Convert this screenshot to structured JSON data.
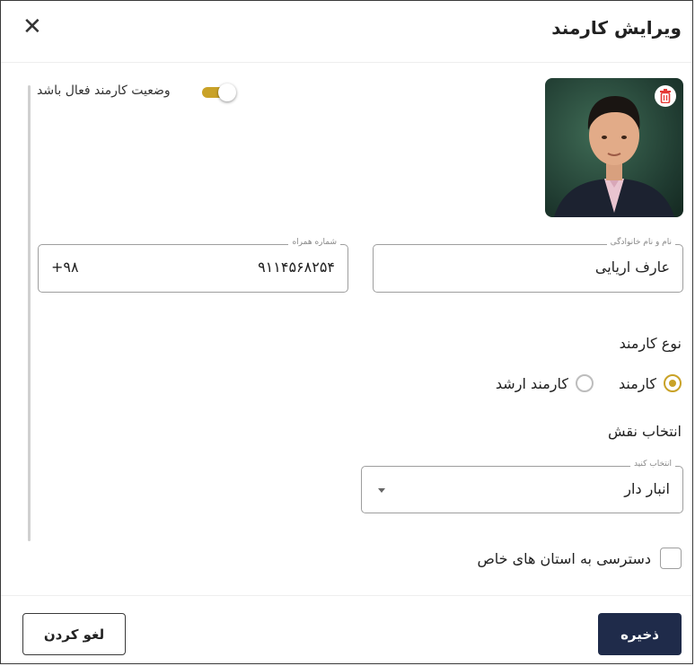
{
  "header": {
    "title": "ویرایش کارمند",
    "close_icon": "close-icon"
  },
  "status": {
    "label": "وضعیت کارمند فعال باشد",
    "active": true,
    "accent": "#c9a227"
  },
  "photo": {
    "delete_icon": "trash-icon"
  },
  "fields": {
    "full_name": {
      "label": "نام و نام خانوادگی",
      "value": "عارف اریایی"
    },
    "mobile": {
      "label": "شماره همراه",
      "value": "۹۱۱۴۵۶۸۲۵۴",
      "prefix": "+۹۸"
    }
  },
  "employee_type": {
    "title": "نوع کارمند",
    "options": [
      {
        "label": "کارمند",
        "selected": true
      },
      {
        "label": "کارمند ارشد",
        "selected": false
      }
    ]
  },
  "role": {
    "title": "انتخاب نقش",
    "select_label": "انتخاب کنید",
    "value": "انبار دار"
  },
  "province_access": {
    "label": "دسترسی به استان های خاص",
    "checked": false
  },
  "footer": {
    "save_label": "ذخیره",
    "cancel_label": "لغو کردن",
    "save_color": "#1f2b4a"
  }
}
